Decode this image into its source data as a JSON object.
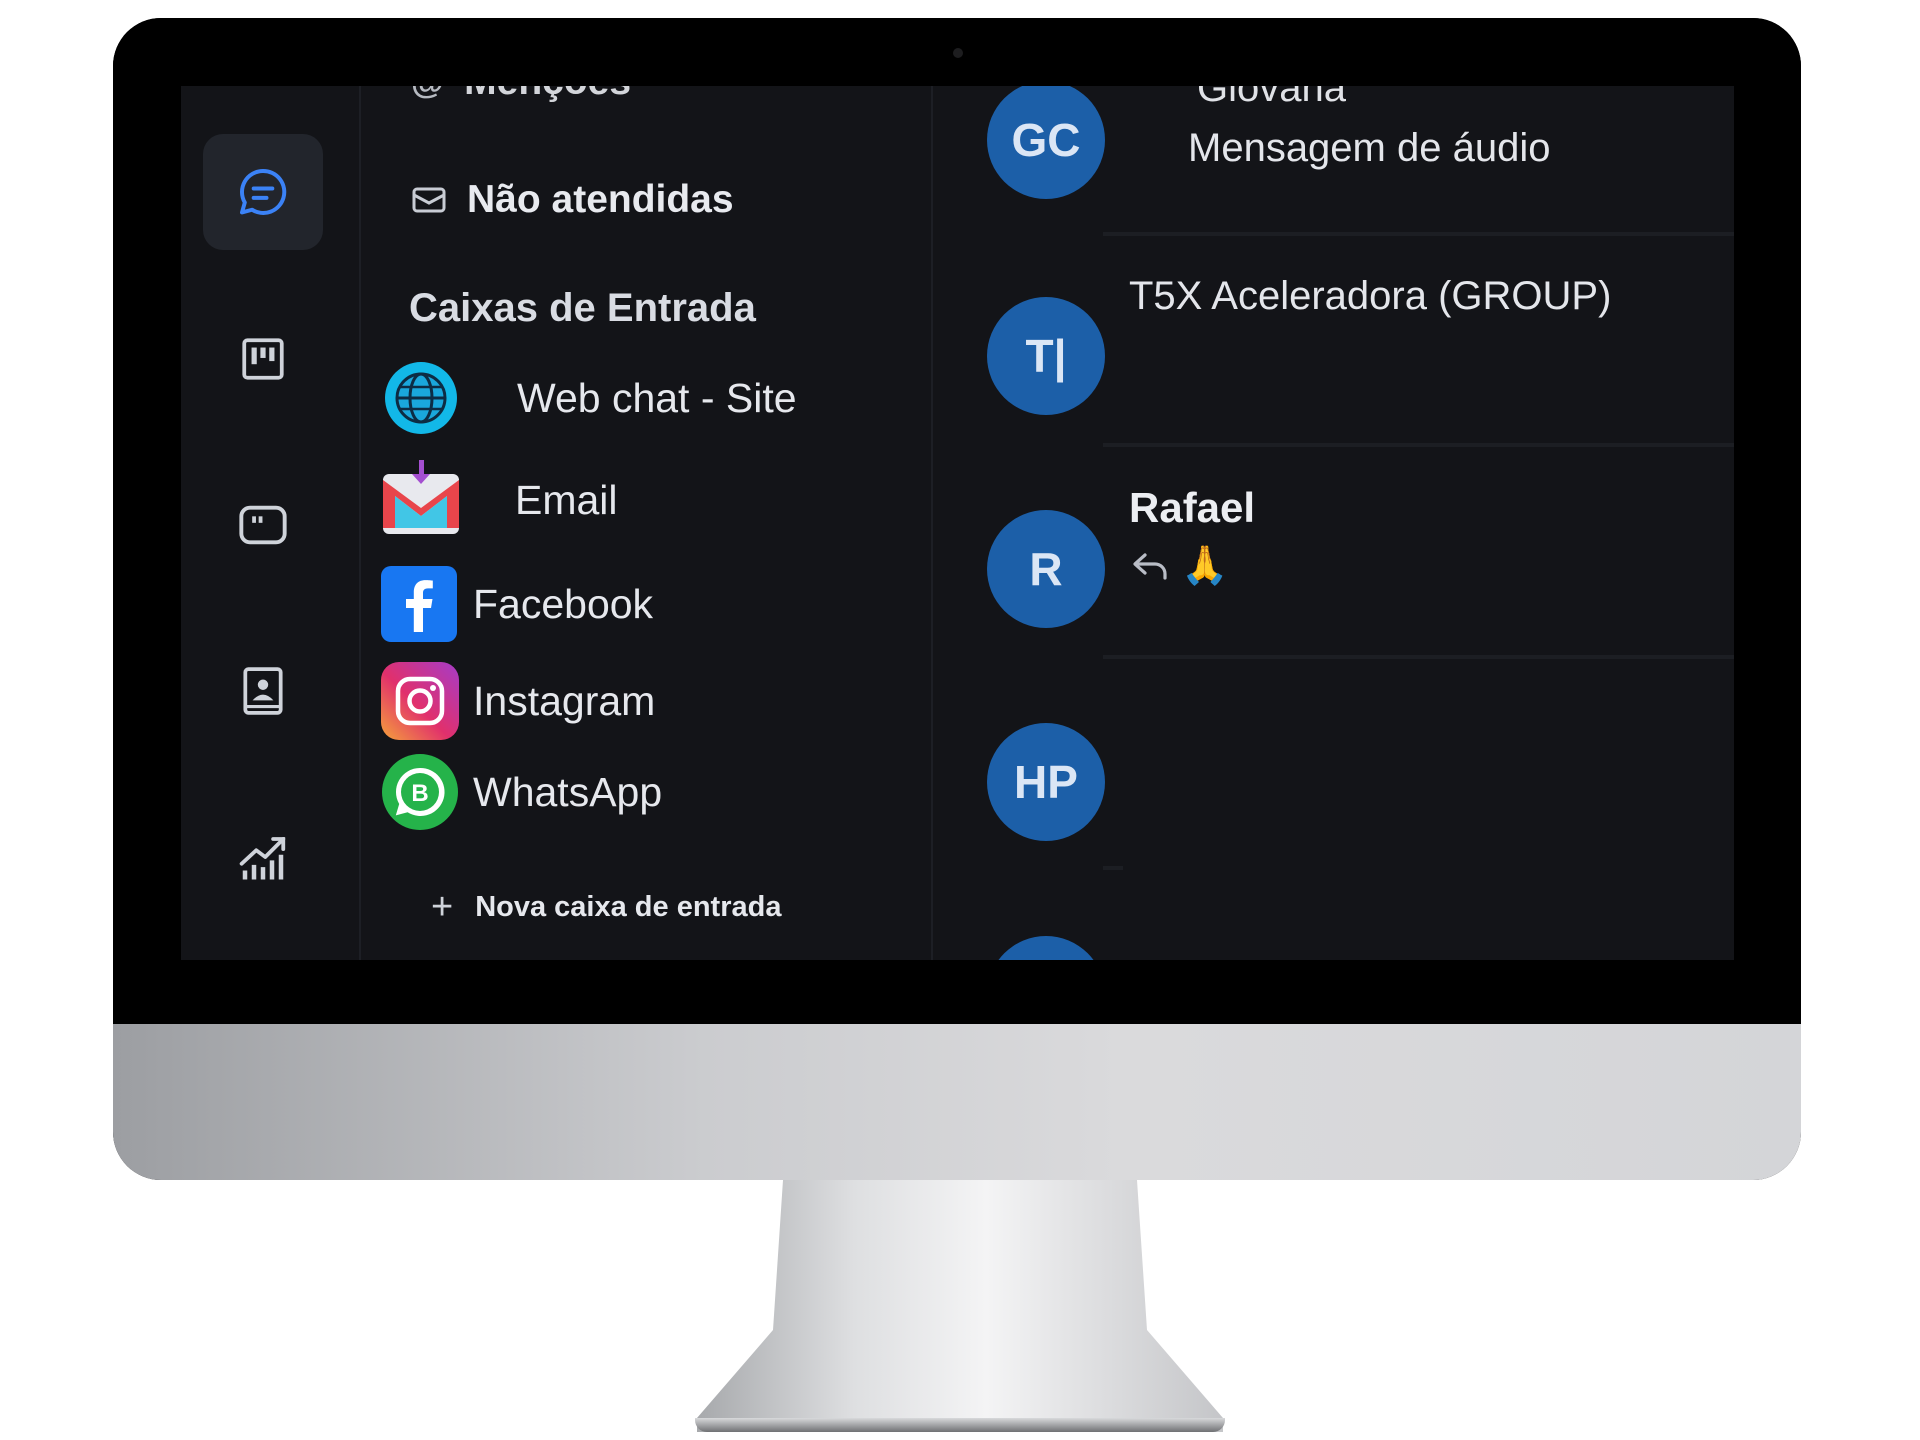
{
  "sidebar": {
    "icons": [
      "chat-bubble-icon",
      "kanban-icon",
      "widget-icon",
      "contacts-icon",
      "reports-icon"
    ]
  },
  "inbox_panel": {
    "top_item_partial": "Menções",
    "unattended": "Não atendidas",
    "section_title": "Caixas de Entrada",
    "inboxes": [
      {
        "label": "Web chat - Site",
        "icon": "globe-icon"
      },
      {
        "label": "Email",
        "icon": "gmail-icon"
      },
      {
        "label": "Facebook",
        "icon": "facebook-icon"
      },
      {
        "label": "Instagram",
        "icon": "instagram-icon"
      },
      {
        "label": "WhatsApp",
        "icon": "whatsapp-icon"
      }
    ],
    "new_inbox": "Nova caixa de entrada"
  },
  "conversations": [
    {
      "initials": "GC",
      "name_partial": "Giovana",
      "preview": "Mensagem de áudio"
    },
    {
      "initials": "T|",
      "name": "T5X Aceleradora (GROUP)"
    },
    {
      "initials": "R",
      "name": "Rafael",
      "preview_emoji": "🙏"
    },
    {
      "initials": "HP"
    }
  ],
  "colors": {
    "screen_bg": "#131418",
    "avatar_bg": "#1c5fa8",
    "accent": "#3b82f6"
  }
}
